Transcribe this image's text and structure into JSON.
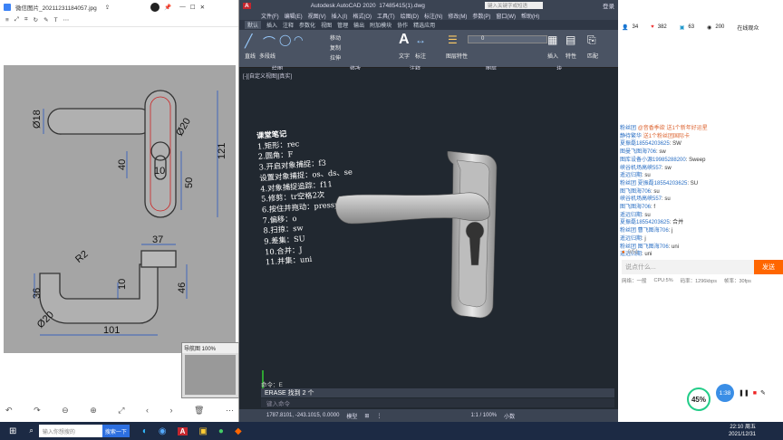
{
  "viewer": {
    "title": "微信图片_20211231184057.jpg",
    "thumb_title": "导航图 100%",
    "dims": [
      "Ø18",
      "Ø20",
      "40",
      "10",
      "50",
      "121",
      "37",
      "R2",
      "10",
      "46",
      "36",
      "Ø20",
      "101"
    ]
  },
  "cad": {
    "app_title": "Autodesk AutoCAD 2020",
    "file_title": "17485415(1).dwg",
    "search_placeholder": "键入关键字或短语",
    "login": "登录",
    "menu": [
      "文件(F)",
      "编辑(E)",
      "视图(V)",
      "插入(I)",
      "格式(O)",
      "工具(T)",
      "绘图(D)",
      "标注(N)",
      "修改(M)",
      "参数(P)",
      "窗口(W)",
      "帮助(H)"
    ],
    "tabs": [
      "默认",
      "插入",
      "注释",
      "参数化",
      "视图",
      "管理",
      "输出",
      "附加模块",
      "协作",
      "精选应用"
    ],
    "groups": [
      "绘图",
      "修改",
      "注释",
      "图层",
      "块"
    ],
    "tools": [
      "直线",
      "多段线",
      "移动",
      "复制",
      "拉伸",
      "文字",
      "标注",
      "图层特性",
      "插入",
      "特性",
      "匹配"
    ],
    "layer_value": "0",
    "viewport_label": "[-][自定义视图][真实]",
    "notes_title": "课堂笔记",
    "notes": [
      "1.矩形：rec",
      "2.圆角：F",
      "3.开启对象捕捉：f3",
      "设置对象捕捉：os、ds、se",
      "4.对象捕捉追踪：f11",
      "5.修剪：tr空格2次",
      "6.按住并拖动：presspull",
      "7.偏移：o",
      "8.扫掠：sw",
      "9.差集：SU",
      "10.合并：J",
      "11.并集：uni"
    ],
    "cmd_history": "命令：E",
    "cmd_current": "ERASE 找到 2 个",
    "cmd_placeholder": "键入命令",
    "coords": "1787.8101, -243.1015, 0.0000",
    "model": "模型",
    "scale": "1:1 / 100%",
    "units": "小数"
  },
  "chat": {
    "stats": [
      "34",
      "382",
      "63",
      "200"
    ],
    "online": "在线观众",
    "messages": [
      {
        "user": "粉丝团",
        "text": "@音香季欲 送1个新年好运星"
      },
      {
        "user": "静待繁华",
        "text": "送1个粉丝团国际卡"
      },
      {
        "user": "夏振磊18554203625",
        "text": "SW"
      },
      {
        "user": "图曼飞图海706",
        "text": "sw"
      },
      {
        "user": "图库设备小源19985288200",
        "text": "Sweep"
      },
      {
        "user": "峡谷机场高峡557",
        "text": "sw"
      },
      {
        "user": "遥远归期",
        "text": "su"
      },
      {
        "user": "粉丝团 夏振磊18554203625",
        "text": "SU"
      },
      {
        "user": "图飞图海706",
        "text": "su"
      },
      {
        "user": "峡谷机场高峡557",
        "text": "su"
      },
      {
        "user": "图飞图海706",
        "text": "f"
      },
      {
        "user": "遥远归期",
        "text": "su"
      },
      {
        "user": "夏振磊18554203625",
        "text": "合并"
      },
      {
        "user": "粉丝团 曹飞图海706",
        "text": "j"
      },
      {
        "user": "遥远归期",
        "text": "j"
      },
      {
        "user": "粉丝团 图飞图海706",
        "text": "uni"
      },
      {
        "user": "遥远归期",
        "text": "uni"
      }
    ],
    "count": "0/51",
    "input_placeholder": "说点什么...",
    "send": "发送",
    "net": "网络：一般",
    "cpu": "CPU:5%",
    "bitrate": "码率：1296kbps",
    "fps": "帧率：30fps",
    "pct": "45%",
    "rec_time": "1:38"
  },
  "taskbar": {
    "search_placeholder": "输入你想搜的",
    "search_btn": "搜索一下",
    "time": "22:10 周五",
    "date": "2021/12/31"
  }
}
